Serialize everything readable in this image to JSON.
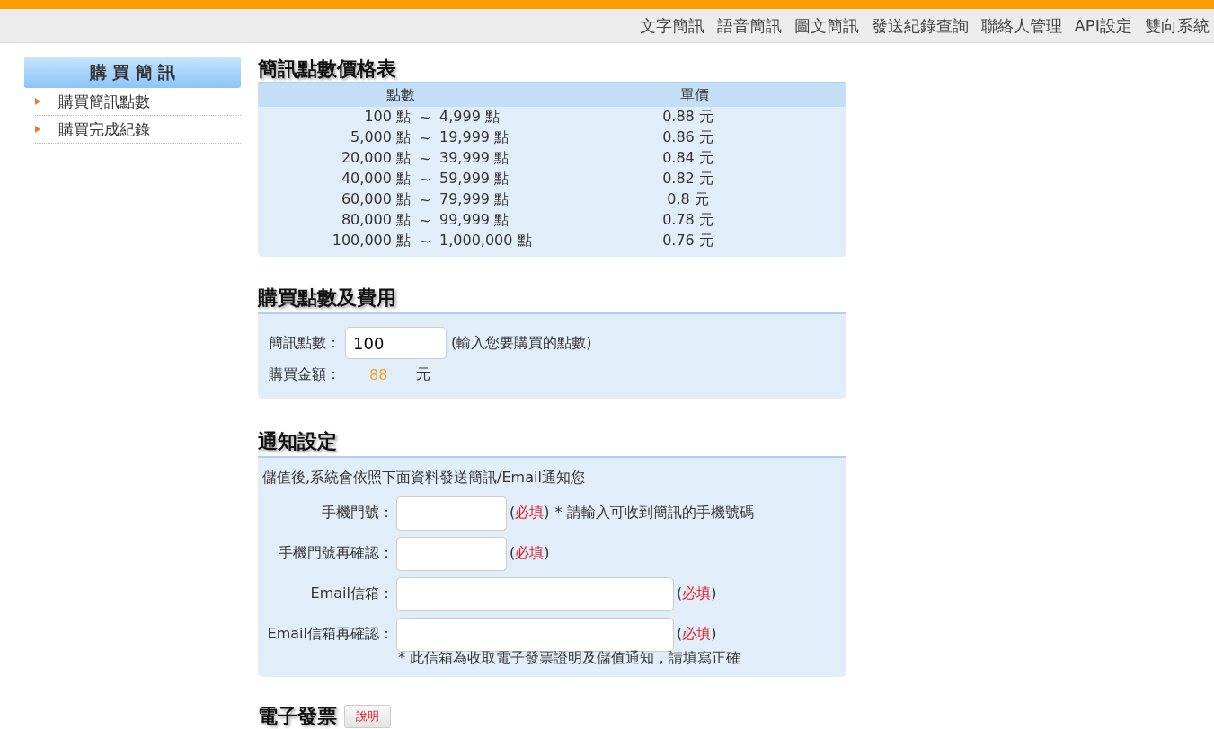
{
  "top_nav": {
    "links": [
      "文字簡訊",
      "語音簡訊",
      "圖文簡訊",
      "發送紀錄查詢",
      "聯絡人管理",
      "API設定",
      "雙向系統"
    ]
  },
  "sidebar": {
    "title": "購 買 簡 訊",
    "items": [
      {
        "label": "購買簡訊點數"
      },
      {
        "label": "購買完成紀錄"
      }
    ]
  },
  "price_table": {
    "title": "簡訊點數價格表",
    "columns": [
      "點數",
      "單價"
    ],
    "rows": [
      {
        "from": "100 點",
        "separator": "~",
        "to": "4,999 點",
        "price": "0.88 元"
      },
      {
        "from": "5,000 點",
        "separator": "~",
        "to": "19,999 點",
        "price": "0.86 元"
      },
      {
        "from": "20,000 點",
        "separator": "~",
        "to": "39,999 點",
        "price": "0.84 元"
      },
      {
        "from": "40,000 點",
        "separator": "~",
        "to": "59,999 點",
        "price": "0.82 元"
      },
      {
        "from": "60,000 點",
        "separator": "~",
        "to": "79,999 點",
        "price": "0.8 元"
      },
      {
        "from": "80,000 點",
        "separator": "~",
        "to": "99,999 點",
        "price": "0.78 元"
      },
      {
        "from": "100,000 點",
        "separator": "~",
        "to": "1,000,000 點",
        "price": "0.76 元"
      }
    ]
  },
  "purchase": {
    "title": "購買點數及費用",
    "points_label": "簡訊點數：",
    "points_value": "100",
    "points_hint": "(輸入您要購買的點數)",
    "amount_label": "購買金額：",
    "amount": "88",
    "currency": "元"
  },
  "notification": {
    "title": "通知設定",
    "intro": "儲值後,系統會依照下面資料發送簡訊/Email通知您",
    "fields": [
      {
        "label": "手機門號：",
        "kind": "short",
        "required_open": "(",
        "required_word": "必填",
        "required_close": ")",
        "note": "* 請輸入可收到簡訊的手機號碼"
      },
      {
        "label": "手機門號再確認：",
        "kind": "short",
        "required_open": "(",
        "required_word": "必填",
        "required_close": ")"
      },
      {
        "label": "Email信箱：",
        "kind": "long",
        "required_open": "(",
        "required_word": "必填",
        "required_close": ")"
      },
      {
        "label": "Email信箱再確認：",
        "kind": "long",
        "required_open": "(",
        "required_word": "必填",
        "required_close": ")"
      }
    ],
    "footnote": "* 此信箱為收取電子發票證明及儲值通知，請填寫正確"
  },
  "invoice": {
    "title": "電子發票",
    "help_button": "說明"
  }
}
